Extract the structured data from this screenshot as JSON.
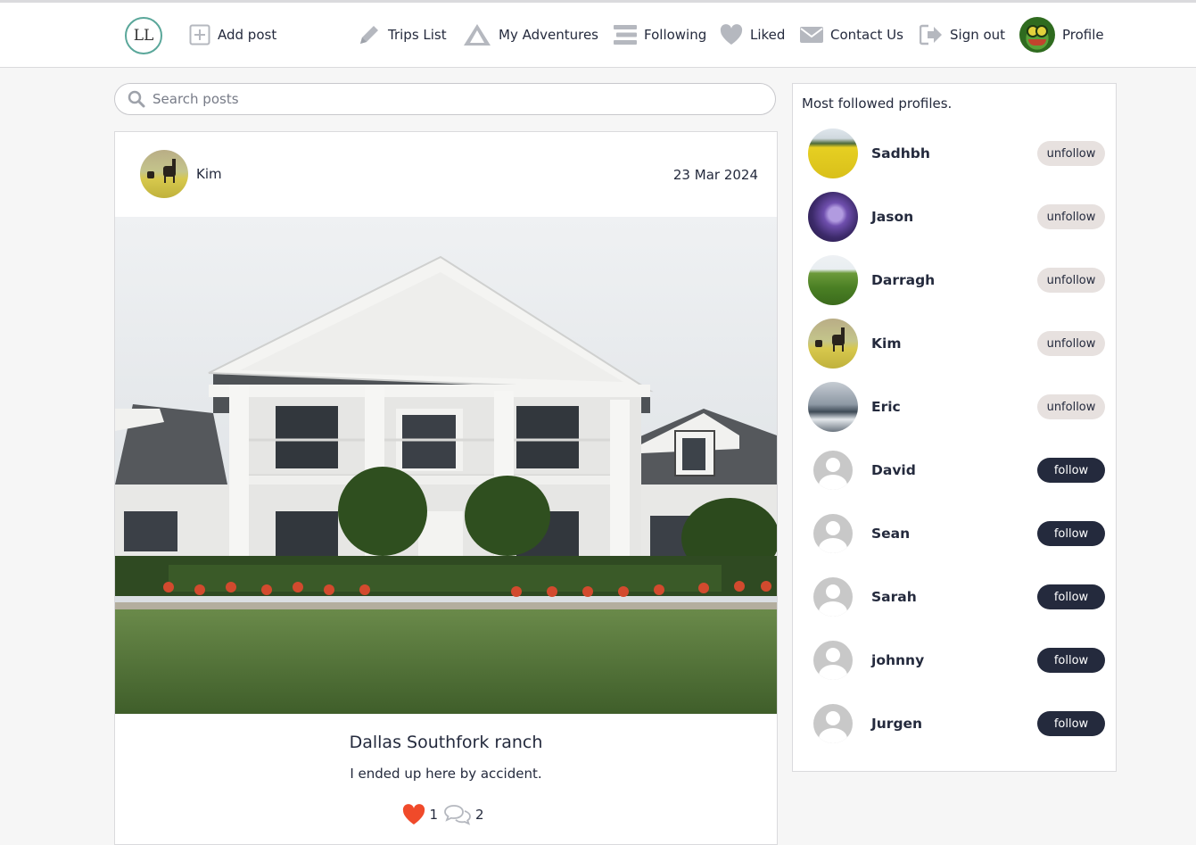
{
  "nav": {
    "logo_text": "LL",
    "items": [
      {
        "label": "Add post",
        "icon": "plus-square-icon"
      },
      {
        "label": "Trips List",
        "icon": "pencil-icon"
      },
      {
        "label": "My Adventures",
        "icon": "mountain-icon"
      },
      {
        "label": "Following",
        "icon": "stream-icon"
      },
      {
        "label": "Liked",
        "icon": "heart-icon"
      },
      {
        "label": "Contact Us",
        "icon": "envelope-icon"
      },
      {
        "label": "Sign out",
        "icon": "sign-out-icon"
      },
      {
        "label": "Profile",
        "icon": "avatar"
      }
    ]
  },
  "search": {
    "placeholder": "Search posts"
  },
  "post": {
    "author": "Kim",
    "date": "23 Mar 2024",
    "title": "Dallas Southfork ranch",
    "description": "I ended up here by accident.",
    "likes": "1",
    "comments": "2"
  },
  "sidebar": {
    "title": "Most followed profiles.",
    "profiles": [
      {
        "name": "Sadhbh",
        "button": "unfollow"
      },
      {
        "name": "Jason",
        "button": "unfollow"
      },
      {
        "name": "Darragh",
        "button": "unfollow"
      },
      {
        "name": "Kim",
        "button": "unfollow"
      },
      {
        "name": "Eric",
        "button": "unfollow"
      },
      {
        "name": "David",
        "button": "follow"
      },
      {
        "name": "Sean",
        "button": "follow"
      },
      {
        "name": "Sarah",
        "button": "follow"
      },
      {
        "name": "johnny",
        "button": "follow"
      },
      {
        "name": "Jurgen",
        "button": "follow"
      }
    ]
  },
  "colors": {
    "primary_dark": "#242a3d",
    "unfollow_bg": "#e7e1df",
    "like_heart": "#f04a2a",
    "logo_ring": "#5aa79a"
  }
}
